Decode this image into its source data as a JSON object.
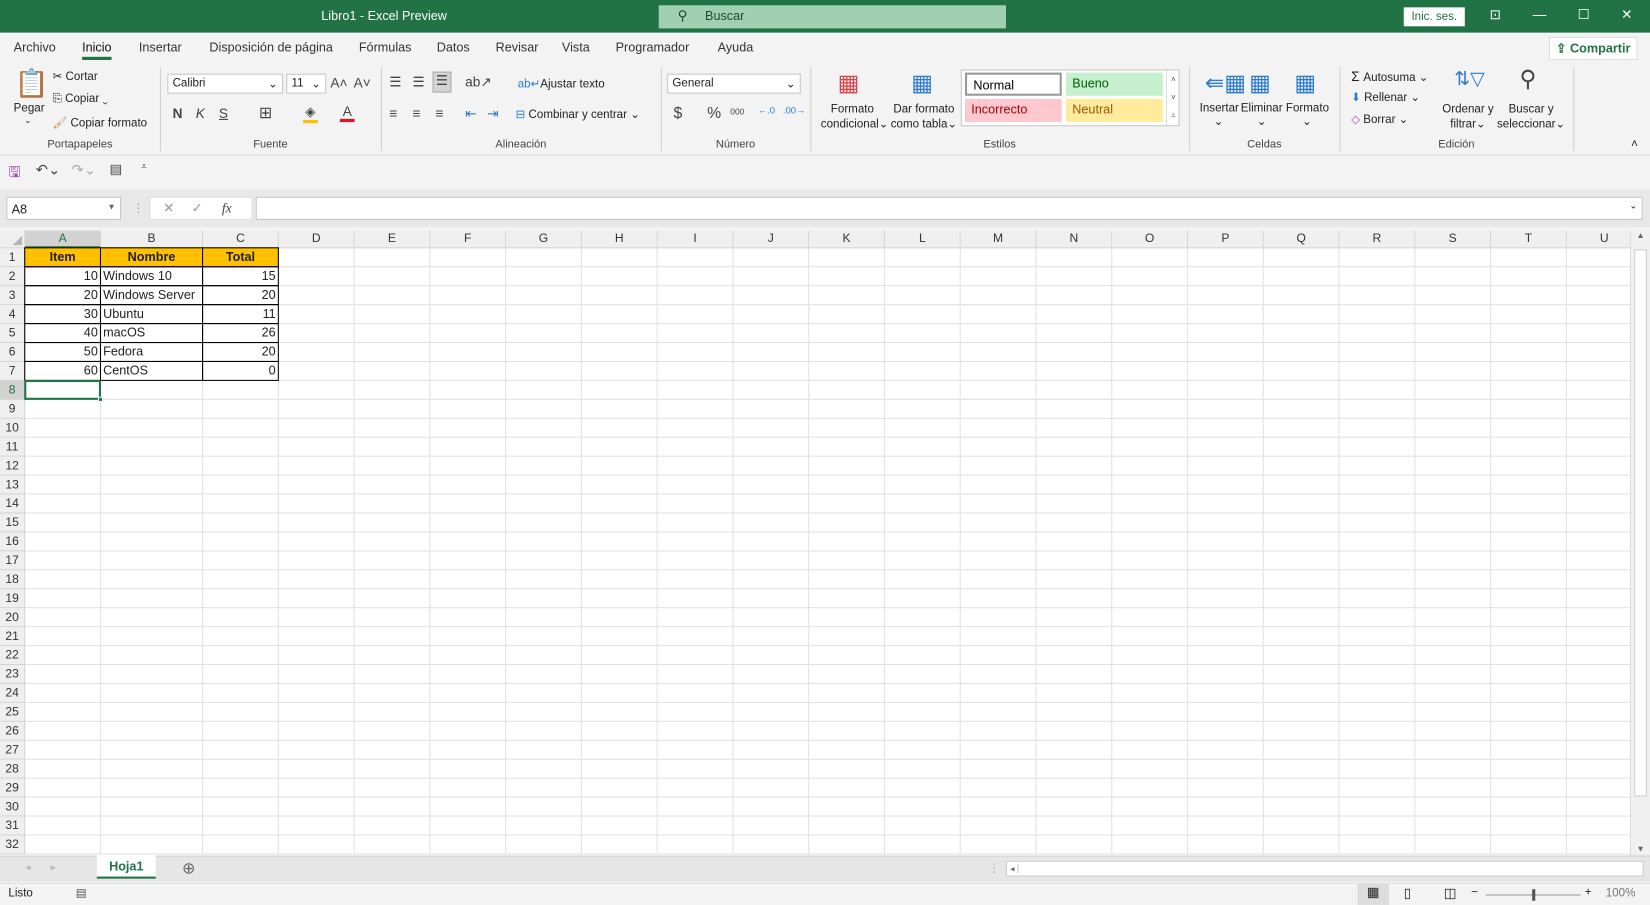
{
  "window": {
    "title": "Libro1  -  Excel Preview",
    "search_placeholder": "Buscar",
    "signin": "Inic. ses."
  },
  "menu_tabs": [
    "Archivo",
    "Inicio",
    "Insertar",
    "Disposición de página",
    "Fórmulas",
    "Datos",
    "Revisar",
    "Vista",
    "Programador",
    "Ayuda"
  ],
  "active_tab": "Inicio",
  "share": "Compartir",
  "ribbon": {
    "clipboard": {
      "label": "Portapapeles",
      "paste": "Pegar",
      "cut": "Cortar",
      "copy": "Copiar",
      "format_painter": "Copiar formato"
    },
    "font": {
      "label": "Fuente",
      "font_name": "Calibri",
      "font_size": "11",
      "bold": "N",
      "italic": "K",
      "underline": "S",
      "fill_color": "#ffc000",
      "font_color": "#e81123"
    },
    "alignment": {
      "label": "Alineación",
      "wrap": "Ajustar texto",
      "merge": "Combinar y centrar"
    },
    "number": {
      "label": "Número",
      "format": "General",
      "currency": "$",
      "percent": "%",
      "thousands": "000"
    },
    "styles": {
      "label": "Estilos",
      "conditional": [
        "Formato",
        "condicional"
      ],
      "table": [
        "Dar formato",
        "como tabla"
      ],
      "gallery": [
        {
          "name": "Normal",
          "bg": "#ffffff",
          "fg": "#000000"
        },
        {
          "name": "Bueno",
          "bg": "#c6efce",
          "fg": "#006100"
        },
        {
          "name": "Incorrecto",
          "bg": "#ffc7ce",
          "fg": "#9c0006"
        },
        {
          "name": "Neutral",
          "bg": "#ffeb9c",
          "fg": "#9c5700"
        }
      ]
    },
    "cells": {
      "label": "Celdas",
      "insert": "Insertar",
      "delete": "Eliminar",
      "format": "Formato"
    },
    "editing": {
      "label": "Edición",
      "autosum": "Autosuma",
      "fill": "Rellenar",
      "clear": "Borrar",
      "sort": [
        "Ordenar y",
        "filtrar"
      ],
      "find": [
        "Buscar y",
        "seleccionar"
      ]
    }
  },
  "formula_bar": {
    "name_box": "A8",
    "fx": "fx",
    "value": ""
  },
  "sheet": {
    "columns": [
      "A",
      "B",
      "C",
      "D",
      "E",
      "F",
      "G",
      "H",
      "I",
      "J",
      "K",
      "L",
      "M",
      "N",
      "O",
      "P",
      "Q",
      "R",
      "S",
      "T",
      "U"
    ],
    "row_count": 32,
    "selected_cell": "A8",
    "header_fill": "#ffc000",
    "table": {
      "headers": [
        "Item",
        "Nombre",
        "Total"
      ],
      "rows": [
        [
          "10",
          "Windows 10",
          "15"
        ],
        [
          "20",
          "Windows Server",
          "20"
        ],
        [
          "30",
          "Ubuntu",
          "11"
        ],
        [
          "40",
          "macOS",
          "26"
        ],
        [
          "50",
          "Fedora",
          "20"
        ],
        [
          "60",
          "CentOS",
          "0"
        ]
      ]
    }
  },
  "sheet_tabs": [
    "Hoja1"
  ],
  "status": {
    "text": "Listo",
    "zoom": "100%"
  }
}
